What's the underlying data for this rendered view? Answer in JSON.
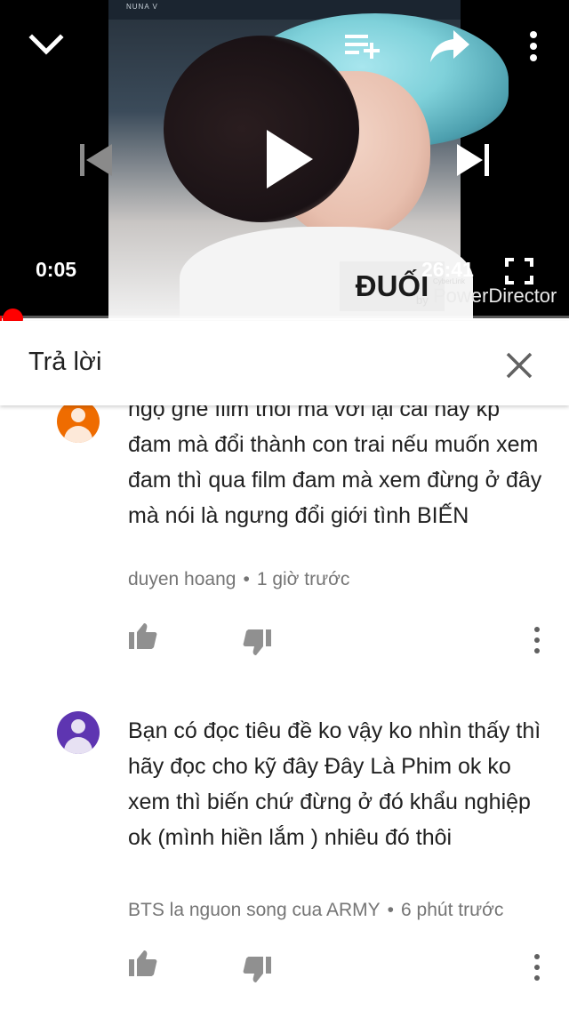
{
  "player": {
    "current_time": "0:05",
    "duration": "26:41",
    "progress_fraction": 0.003,
    "frame": {
      "top_tag": "NUNA V",
      "caption": "ĐUỐI",
      "watermark_small": "CyberLink",
      "watermark_by": "by",
      "watermark_main": "PowerDirector"
    },
    "icons": {
      "collapse": "chevron-down-icon",
      "add_to_queue": "playlist-add-icon",
      "share": "share-icon",
      "more": "more-vert-icon",
      "previous": "skip-previous-icon",
      "play": "play-icon",
      "next": "skip-next-icon",
      "fullscreen": "fullscreen-icon"
    },
    "colors": {
      "progress": "#ff0000"
    }
  },
  "reply_panel": {
    "title": "Trả lời",
    "close_icon": "close-icon"
  },
  "comments": [
    {
      "text": "ngộ ghê film thôi mà với lại cái này kp đam mà đổi thành con trai nếu muốn xem đam thì qua film đam mà xem đừng ở đây mà nói là ngưng đổi giới tình BIẾN",
      "author": "duyen hoang",
      "separator": "•",
      "time": "1 giờ trước",
      "avatar_color": "#ef6c00"
    },
    {
      "text": "Bạn có đọc tiêu đề ko vậy ko nhìn thấy thì hãy đọc cho kỹ đây Đây Là Phim ok ko xem thì biến chứ đừng ở đó khẩu nghiệp ok (mình hiền lắm ) nhiêu đó thôi",
      "author": "BTS la nguon song cua ARMY",
      "separator": "•",
      "time": "6 phút trước",
      "avatar_color": "#5e35b1"
    }
  ]
}
